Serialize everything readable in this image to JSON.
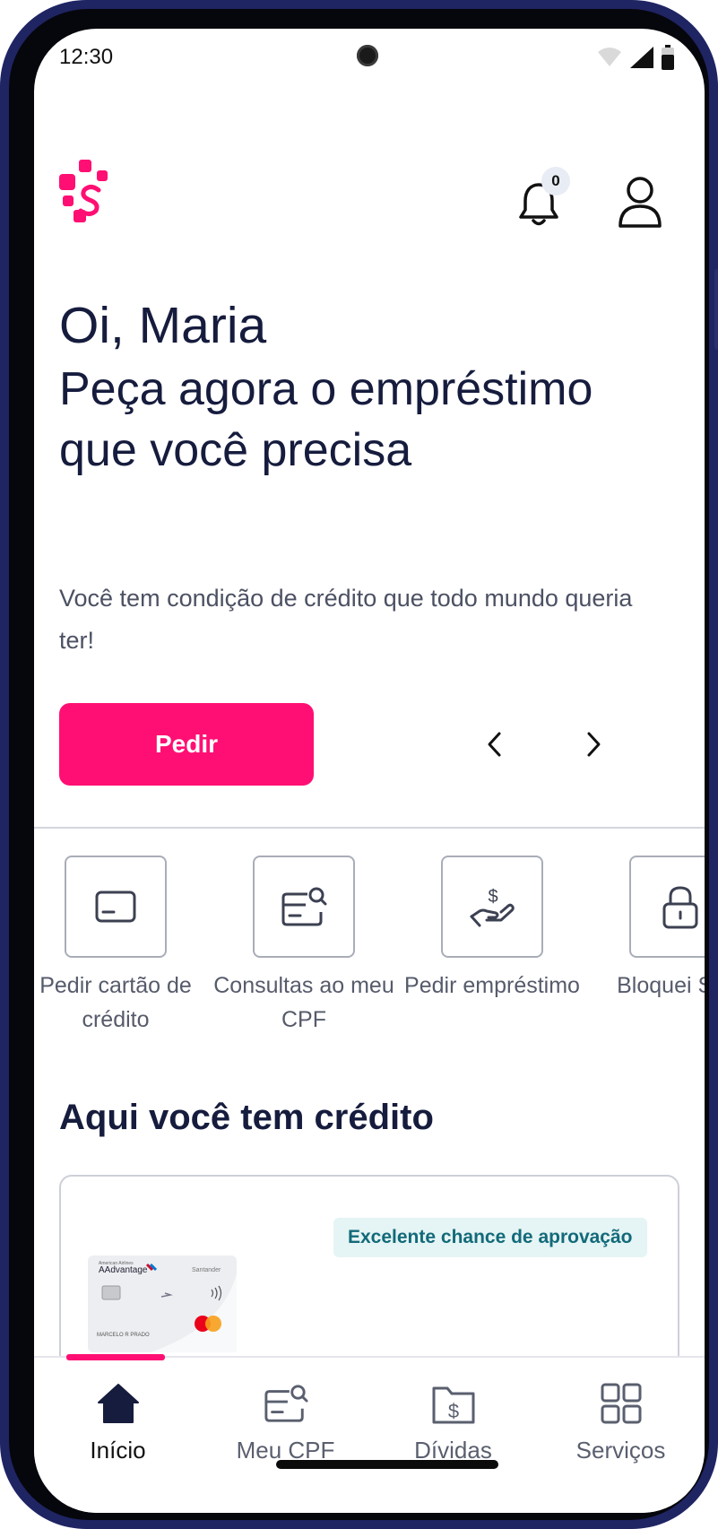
{
  "status_bar": {
    "time": "12:30"
  },
  "header": {
    "notification_count": "0"
  },
  "hero": {
    "greeting": "Oi, Maria",
    "headline": "Peça agora o empréstimo que você precisa",
    "subtitle": "Você tem condição de crédito que todo mundo queria ter!",
    "cta_label": "Pedir"
  },
  "shortcuts": [
    {
      "label": "Pedir cartão de crédito",
      "icon": "credit-card-icon"
    },
    {
      "label": "Consultas ao meu CPF",
      "icon": "card-search-icon"
    },
    {
      "label": "Pedir empréstimo",
      "icon": "hand-money-icon"
    },
    {
      "label": "Bloquei Scor",
      "icon": "lock-icon"
    }
  ],
  "credit_section": {
    "title": "Aqui você tem crédito",
    "approval_badge": "Excelente chance de aprovação",
    "card_brand": "AAdvantage",
    "card_bank": "Santander",
    "card_holder": "MARCELO R PRADO",
    "card_airline": "American Airlines"
  },
  "bottom_nav": [
    {
      "label": "Início",
      "icon": "home-icon",
      "active": true
    },
    {
      "label": "Meu CPF",
      "icon": "card-search-icon",
      "active": false
    },
    {
      "label": "Dívidas",
      "icon": "folder-money-icon",
      "active": false
    },
    {
      "label": "Serviços",
      "icon": "grid-icon",
      "active": false
    }
  ],
  "colors": {
    "brand": "#ff0f73",
    "text_dark": "#161c3d",
    "badge_text": "#126a7a",
    "badge_bg": "#e5f4f4",
    "frame": "#1f2463"
  }
}
